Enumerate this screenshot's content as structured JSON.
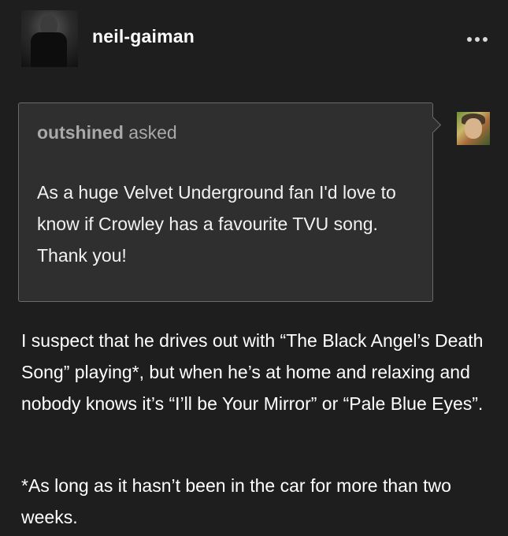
{
  "post": {
    "author": "neil-gaiman",
    "more_icon": "more-horizontal-icon"
  },
  "ask": {
    "asker_name": "outshined",
    "asked_label": " asked",
    "question": "As a huge Velvet Underground fan I'd love to know if Crowley has a favourite TVU song. Thank you!"
  },
  "answer": {
    "paragraph": "I suspect that he drives out with “The Black Angel’s Death Song” playing*, but when he’s at home and relaxing and nobody knows it’s “I’ll be Your Mirror” or “Pale Blue Eyes”.",
    "footnote": "*As long as it hasn’t been in the car for more than two weeks."
  },
  "colors": {
    "background": "#1e1e1f",
    "ask_box": "#2f2f30",
    "ask_border": "#6a6a6b",
    "muted_text": "#a9a9aa"
  }
}
